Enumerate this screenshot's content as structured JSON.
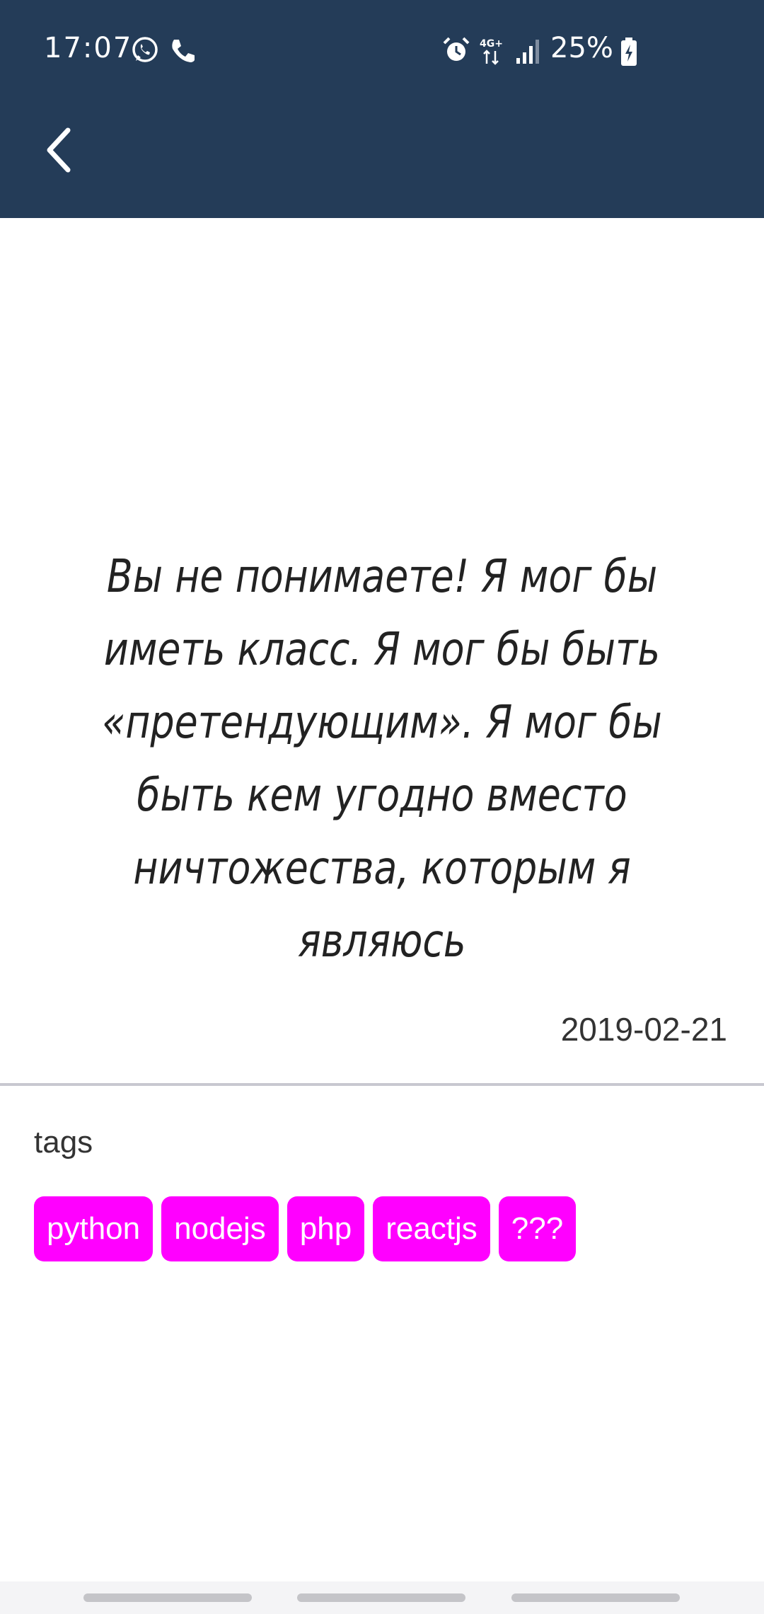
{
  "status_bar": {
    "time": "17:07",
    "network": "4G+",
    "battery": "25%",
    "icons": [
      "whatsapp-icon",
      "phone-icon",
      "alarm-icon",
      "network-arrows-icon",
      "signal-icon",
      "battery-charging-icon"
    ]
  },
  "app_bar": {
    "back_icon": "chevron-left-icon",
    "background_color": "#243c58"
  },
  "quote": {
    "text": "Вы не понимаете! Я мог бы иметь класс. Я мог бы быть «претендующим». Я мог бы быть кем угодно вместо ничтожества, которым я являюсь",
    "date": "2019-02-21"
  },
  "tags": {
    "heading": "tags",
    "chip_color": "#ff00ff",
    "items": [
      "python",
      "nodejs",
      "php",
      "reactjs",
      "???"
    ]
  }
}
